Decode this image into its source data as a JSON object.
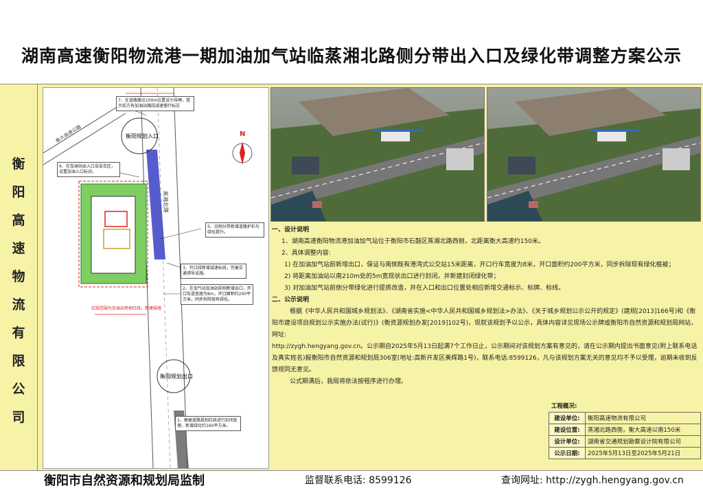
{
  "title": "湖南高速衡阳物流港一期加油加气站临蒸湘北路侧分带出入口及绿化带调整方案公示",
  "side_label": [
    "衡",
    "阳",
    "高",
    "速",
    "物",
    "流",
    "有",
    "限",
    "公",
    "司"
  ],
  "plan": {
    "north": "N",
    "entrance_label": "衡阳规划入口",
    "exit_label": "衡阳规划出口",
    "road_label": "蒸湘北路",
    "road_label_left": "衡大高速公路",
    "notes": [
      "7、在道路路沿100m位置设引导牌，提示前方有加油站路段减速慢行标志",
      "6、在加油站出入口设会车区，设置加油入口标识。",
      "5、沿侧分带新增道路护栏与绿化提升。",
      "3、开口段新增减速标线，完善交通诱导设施。",
      "2、在加气站加油站前侧新增出口，开口车道宽度为8m，开口面积约200平方米，同步拆除现有绿化。",
      "1、根据道路规划红线进行封闭处理，新增绿化约160平方米。"
    ],
    "legend": "红线范围为加油站用地红线，新建围墙"
  },
  "photos": [
    {
      "name": "aerial-before"
    },
    {
      "name": "aerial-after"
    }
  ],
  "description": {
    "s1_heading": "一、设计说明",
    "s1_p1": "1、湖南高速衡阳物流港加油加气站位于衡阳市石鼓区蒸湘北路西侧，北距离衡大高速约150米。",
    "s1_p2": "2、具体调整内容:",
    "s1_items": [
      "1) 在加油加气站前新增出口，保证与南侧既有港湾式公交站15米距离，开口行车宽度为8米，开口面积约200平方米，同步拆除现有绿化植被；",
      "2) 将距离加油站以南210m处的5m宽现状出口进行封闭，并新建封闭绿化带；",
      "3) 对加油加气站前侧分带绿化进行提质改造，并在入口和出口位置处相应新增交通标示、标牌、标线。"
    ],
    "s2_heading": "二、公示说明",
    "s2_p1": "根据《中华人民共和国城乡规划法》、《湖南省实施<中华人民共和国城乡规划法>办法》、《关于城乡规划公示公开的规定》(建规[2013]166号)和《衡阳市建设项目规划公示实施办法(试行)》(衡资源规划办发[2019]102号)，现就该规划予以公示，具体内容详见现场公示牌或衡阳市自然资源和规划局网站，网址:",
    "s2_p2": "http://zygh.hengyang.gov.cn。公示期自2025年5月13日起满7个工作日止，公示期间对该规划方案有意见的，请在公示期内提出书面意见(附上联系电话及真实姓名)报衡阳市自然资源和规划局306室(地址:高新开发区美辉路1号)，联系电话:8599126，凡与该规划方案无关的意见均不予以受理，逾期未收到反馈视同无意见。",
    "s2_p3": "公式期满后，我局将依法按程序进行办理。"
  },
  "project_info": {
    "caption": "工程概况:",
    "rows": [
      {
        "key": "建设单位:",
        "value": "衡阳高速物流有限公司"
      },
      {
        "key": "建设位置:",
        "value": "蒸湘北路西侧，衡大高速以南150米"
      },
      {
        "key": "设计单位:",
        "value": "湖南省交通规划勘察设计院有限公司"
      },
      {
        "key": "公示日期:",
        "value": "2025年5月13日至2025年5月21日"
      }
    ]
  },
  "footer": {
    "supervisor": "衡阳市自然资源和规划局监制",
    "phone": "监督联系电话: 8599126",
    "website": "查询网址: http://zygh.hengyang.gov.cn"
  },
  "colors": {
    "panel": "#f7f3a6",
    "road_blue": "#3a3fc4",
    "green_zone": "#7ecf62",
    "red_line": "#d22"
  }
}
